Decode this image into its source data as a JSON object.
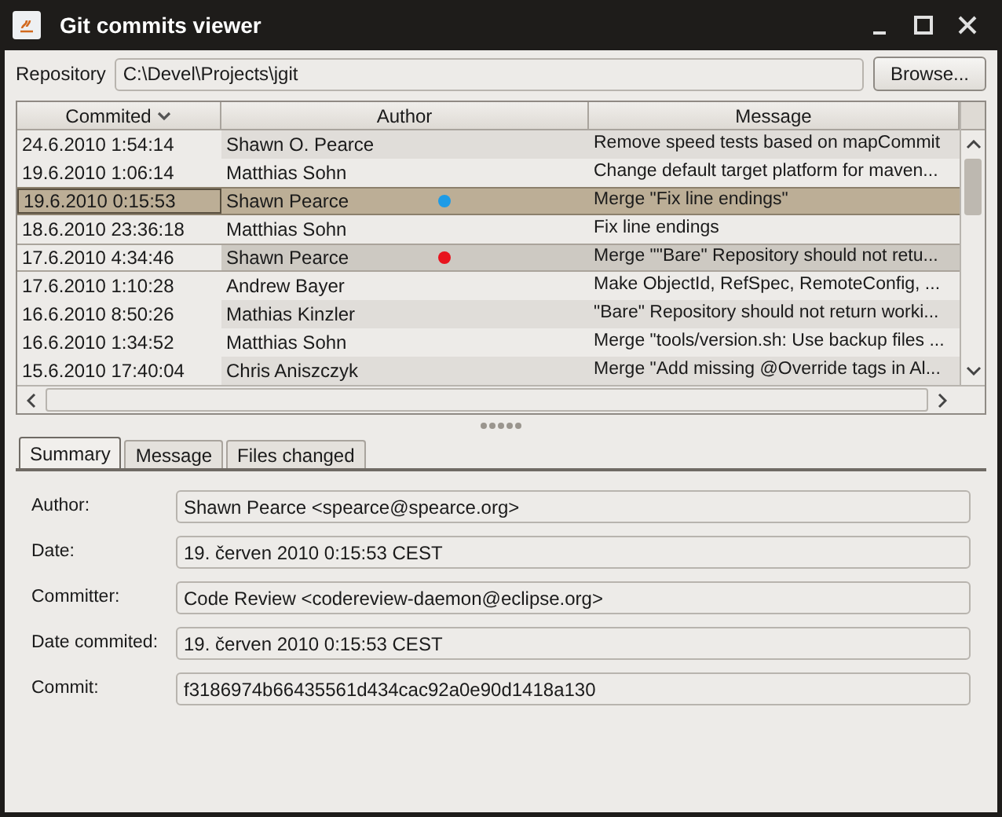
{
  "window": {
    "title": "Git commits viewer"
  },
  "repository": {
    "label": "Repository",
    "value": "C:\\Devel\\Projects\\jgit",
    "button": "Browse..."
  },
  "table": {
    "columns": [
      {
        "label": "Commited",
        "sorted": true
      },
      {
        "label": "Author",
        "sorted": false
      },
      {
        "label": "Message",
        "sorted": false
      }
    ],
    "rows": [
      {
        "committed": "24.6.2010 1:54:14",
        "author": "Shawn O. Pearce",
        "message": "Remove speed tests based on mapCommit",
        "selected": false,
        "shaded": true
      },
      {
        "committed": "19.6.2010 1:06:14",
        "author": "Matthias Sohn",
        "message": "Change default target platform for maven...",
        "selected": false,
        "shaded": false
      },
      {
        "committed": "19.6.2010 0:15:53",
        "author": "Shawn Pearce",
        "message": "Merge \"Fix line endings\"",
        "selected": true,
        "color": "#1e9be6"
      },
      {
        "committed": "18.6.2010 23:36:18",
        "author": "Matthias Sohn",
        "message": "Fix line endings",
        "selected": false,
        "shaded": false
      },
      {
        "committed": "17.6.2010 4:34:46",
        "author": "Shawn Pearce",
        "message": "Merge \"\"Bare\" Repository should not retu...",
        "selected": false,
        "highlighted": true,
        "color": "#e8141e"
      },
      {
        "committed": "17.6.2010 1:10:28",
        "author": "Andrew Bayer",
        "message": "Make ObjectId, RefSpec, RemoteConfig, ...",
        "selected": false,
        "shaded": false
      },
      {
        "committed": "16.6.2010 8:50:26",
        "author": "Mathias Kinzler",
        "message": "\"Bare\" Repository should not return worki...",
        "selected": false,
        "shaded": true
      },
      {
        "committed": "16.6.2010 1:34:52",
        "author": "Matthias Sohn",
        "message": "Merge \"tools/version.sh: Use backup files ...",
        "selected": false,
        "shaded": false
      },
      {
        "committed": "15.6.2010 17:40:04",
        "author": "Chris Aniszczyk",
        "message": "Merge \"Add missing @Override tags in Al...",
        "selected": false,
        "shaded": true
      }
    ]
  },
  "tabs": [
    {
      "label": "Summary",
      "selected": true
    },
    {
      "label": "Message",
      "selected": false
    },
    {
      "label": "Files changed",
      "selected": false
    }
  ],
  "summary": [
    {
      "label": "Author:",
      "value": "Shawn Pearce <spearce@spearce.org>"
    },
    {
      "label": "Date:",
      "value": "19. červen 2010 0:15:53 CEST"
    },
    {
      "label": "Committer:",
      "value": "Code Review <codereview-daemon@eclipse.org>"
    },
    {
      "label": "Date commited:",
      "value": "19. červen 2010 0:15:53 CEST"
    },
    {
      "label": "Commit:",
      "value": "f3186974b66435561d434cac92a0e90d1418a130"
    }
  ]
}
